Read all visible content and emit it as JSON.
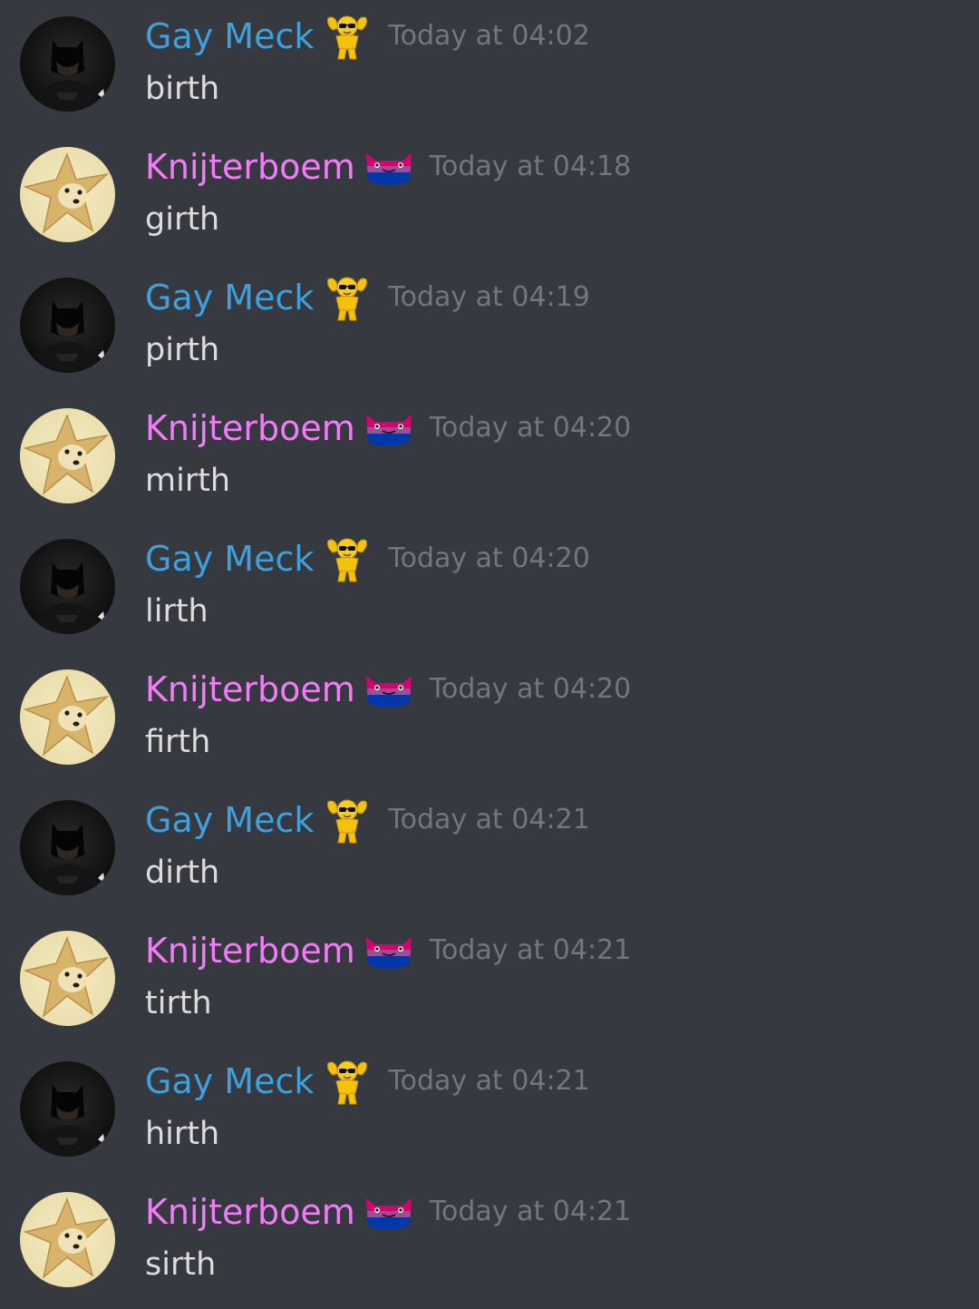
{
  "colors": {
    "background": "#36393f",
    "gay_meck_name": "#3fa0dc",
    "knijterboem_name": "#f07cf6",
    "timestamp": "#72767d",
    "message_text": "#dcddde"
  },
  "users": {
    "gaymeck": {
      "name": "Gay Meck",
      "avatar_icon": "batman-avatar-icon",
      "badge_icon": "muscular-sunglasses-emoji-icon"
    },
    "knijter": {
      "name": "Knijterboem",
      "avatar_icon": "star-doge-avatar-icon",
      "badge_icon": "bi-flag-cat-icon"
    }
  },
  "messages": [
    {
      "user": "gaymeck",
      "name": "Gay Meck",
      "time": "Today at 04:02",
      "text": "birth"
    },
    {
      "user": "knijter",
      "name": "Knijterboem",
      "time": "Today at 04:18",
      "text": "girth"
    },
    {
      "user": "gaymeck",
      "name": "Gay Meck",
      "time": "Today at 04:19",
      "text": "pirth"
    },
    {
      "user": "knijter",
      "name": "Knijterboem",
      "time": "Today at 04:20",
      "text": "mirth"
    },
    {
      "user": "gaymeck",
      "name": "Gay Meck",
      "time": "Today at 04:20",
      "text": "lirth"
    },
    {
      "user": "knijter",
      "name": "Knijterboem",
      "time": "Today at 04:20",
      "text": "firth"
    },
    {
      "user": "gaymeck",
      "name": "Gay Meck",
      "time": "Today at 04:21",
      "text": "dirth"
    },
    {
      "user": "knijter",
      "name": "Knijterboem",
      "time": "Today at 04:21",
      "text": "tirth"
    },
    {
      "user": "gaymeck",
      "name": "Gay Meck",
      "time": "Today at 04:21",
      "text": "hirth"
    },
    {
      "user": "knijter",
      "name": "Knijterboem",
      "time": "Today at 04:21",
      "text": "sirth"
    }
  ]
}
